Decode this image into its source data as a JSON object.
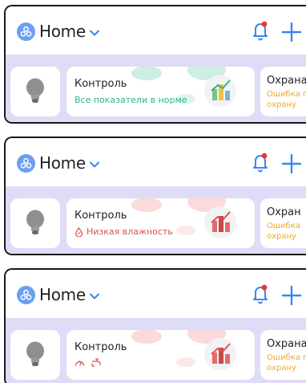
{
  "home": {
    "label": "Home"
  },
  "panels": [
    {
      "control": {
        "title": "Контроль",
        "status": "Все показатели в норме"
      },
      "guard": {
        "title": "Охрана",
        "line1": "Ошибка п",
        "line2": "охрану"
      }
    },
    {
      "control": {
        "title": "Контроль",
        "status": "Низкая влажность"
      },
      "guard": {
        "title": "Охран",
        "line1": "Ошибка",
        "line2": "охрану"
      }
    },
    {
      "control": {
        "title": "Контроль"
      },
      "guard": {
        "title": "Охрана",
        "line1": "Ошибка п",
        "line2": "охрану"
      }
    }
  ],
  "colors": {
    "accent": "#3a86f0",
    "ok": "#2fb37e",
    "alert": "#e05050",
    "warning": "#f0a830",
    "strip": "#dedcf6",
    "bell_dot": "#e53935"
  }
}
